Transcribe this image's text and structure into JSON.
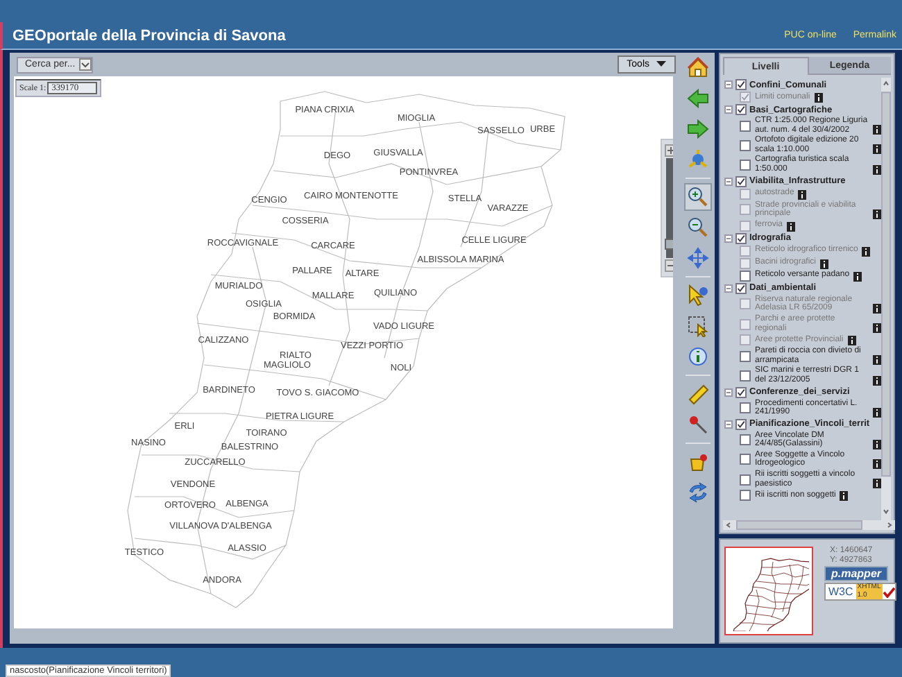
{
  "header": {
    "title": "GEOportale della Provincia di Savona",
    "links": [
      "PUC on-line",
      "Permalink"
    ]
  },
  "map_toolbar": {
    "search": {
      "label": "Cerca per..."
    },
    "tools_button": {
      "label": "Tools"
    }
  },
  "scale": {
    "label": "Scale 1:",
    "value": "339170"
  },
  "map": {
    "towns": [
      "PIANA CRIXIA",
      "MIOGLIA",
      "SASSELLO",
      "URBE",
      "DEGO",
      "GIUSVALLA",
      "PONTINVREA",
      "CENGIO",
      "CAIRO MONTENOTTE",
      "STELLA",
      "VARAZZE",
      "COSSERIA",
      "ROCCAVIGNALE",
      "CARCARE",
      "CELLE LIGURE",
      "ALBISSOLA MARINA",
      "PALLARE",
      "ALTARE",
      "MURIALDO",
      "MALLARE",
      "QUILIANO",
      "OSIGLIA",
      "BORMIDA",
      "VADO LIGURE",
      "CALIZZANO",
      "VEZZI PORTIO",
      "RIALTO",
      "MAGLIOLO",
      "NOLI",
      "BARDINETO",
      "TOVO S. GIACOMO",
      "PIETRA LIGURE",
      "ERLI",
      "TOIRANO",
      "NASINO",
      "BALESTRINO",
      "ZUCCARELLO",
      "VENDONE",
      "ORTOVERO",
      "ALBENGA",
      "VILLANOVA D'ALBENGA",
      "ALASSIO",
      "TESTICO",
      "ANDORA"
    ]
  },
  "zoom_slider": {
    "level": 0.08
  },
  "tools": [
    {
      "kind": "home",
      "selected": false
    },
    {
      "kind": "back",
      "selected": false
    },
    {
      "kind": "forward",
      "selected": false
    },
    {
      "kind": "full",
      "selected": false
    },
    {
      "kind": "zoomin",
      "selected": true
    },
    {
      "kind": "zoomout",
      "selected": false
    },
    {
      "kind": "pan",
      "selected": false
    },
    {
      "kind": "identify",
      "selected": false
    },
    {
      "kind": "select",
      "selected": false
    },
    {
      "kind": "info",
      "selected": false
    },
    {
      "kind": "measure",
      "selected": false
    },
    {
      "kind": "pin",
      "selected": false
    },
    {
      "kind": "print",
      "selected": false
    },
    {
      "kind": "reload",
      "selected": false
    }
  ],
  "tabs": [
    {
      "label": "Livelli",
      "selected": true
    },
    {
      "label": "Legenda",
      "selected": false
    }
  ],
  "layers": [
    {
      "name": "Confini_Comunali",
      "expanded": true,
      "checked": true,
      "children": [
        {
          "label": "Limiti comunali",
          "checked": true,
          "disabled": true
        }
      ]
    },
    {
      "name": "Basi_Cartografiche",
      "expanded": true,
      "checked": true,
      "children": [
        {
          "label": "CTR 1:25.000 Regione Liguria aut. num. 4 del 30/4/2002",
          "checked": false,
          "disabled": false
        },
        {
          "label": "Ortofoto digitale edizione 20 scala 1:10.000",
          "checked": false,
          "disabled": false
        },
        {
          "label": "Cartografia turistica scala 1:50.000",
          "checked": false,
          "disabled": false
        }
      ]
    },
    {
      "name": "Viabilita_Infrastrutture",
      "expanded": true,
      "checked": true,
      "children": [
        {
          "label": "autostrade",
          "checked": false,
          "disabled": true
        },
        {
          "label": "Strade provinciali e viabilita principale",
          "checked": false,
          "disabled": true
        },
        {
          "label": "ferrovia",
          "checked": false,
          "disabled": true
        }
      ]
    },
    {
      "name": "Idrografia",
      "expanded": true,
      "checked": true,
      "children": [
        {
          "label": "Reticolo idrografico tirrenico",
          "checked": false,
          "disabled": true
        },
        {
          "label": "Bacini idrografici",
          "checked": false,
          "disabled": true
        },
        {
          "label": "Reticolo versante padano",
          "checked": false,
          "disabled": false
        }
      ]
    },
    {
      "name": "Dati_ambientali",
      "expanded": true,
      "checked": true,
      "children": [
        {
          "label": "Riserva naturale regionale Adelasia LR 65/2009",
          "checked": false,
          "disabled": true
        },
        {
          "label": "Parchi e aree protette regionali",
          "checked": false,
          "disabled": true
        },
        {
          "label": "Aree protette Provinciali",
          "checked": false,
          "disabled": true
        },
        {
          "label": "Pareti di roccia con divieto di arrampicata",
          "checked": false,
          "disabled": false
        },
        {
          "label": "SIC marini e terrestri DGR 1 del 23/12/2005",
          "checked": false,
          "disabled": false
        }
      ]
    },
    {
      "name": "Conferenze_dei_servizi",
      "expanded": true,
      "checked": true,
      "children": [
        {
          "label": "Procedimenti concertativi L. 241/1990",
          "checked": false,
          "disabled": false
        }
      ]
    },
    {
      "name": "Pianificazione_Vincoli_territ",
      "expanded": true,
      "checked": true,
      "children": [
        {
          "label": "Aree Vincolate DM 24/4/85(Galassini)",
          "checked": false,
          "disabled": false
        },
        {
          "label": "Aree Soggette a Vincolo Idrogeologico",
          "checked": false,
          "disabled": false
        },
        {
          "label": "Rii iscritti soggetti a vincolo paesistico",
          "checked": false,
          "disabled": false
        },
        {
          "label": "Rii iscritti non soggetti",
          "checked": false,
          "disabled": false
        }
      ]
    }
  ],
  "coordinates": {
    "x": "X: 1460647",
    "y": "Y: 4927863"
  },
  "badges": {
    "pmapper": "p.mapper",
    "w3c": "W3C",
    "xhtml": "XHTML",
    "version": "1.0"
  },
  "status_bar": {
    "text": "nascosto(Pianificazione Vincoli territori)"
  }
}
